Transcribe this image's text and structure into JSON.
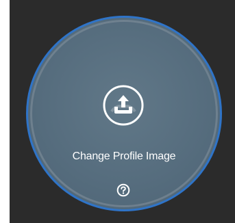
{
  "profile_image": {
    "label": "Change Profile Image",
    "upload_icon": "upload-tray-icon",
    "help_icon": "question-circle-icon",
    "colors": {
      "background": "#2b2b2b",
      "circle_fill": "#566d7e",
      "circle_border": "#2f74c8",
      "foreground": "#ffffff"
    }
  }
}
